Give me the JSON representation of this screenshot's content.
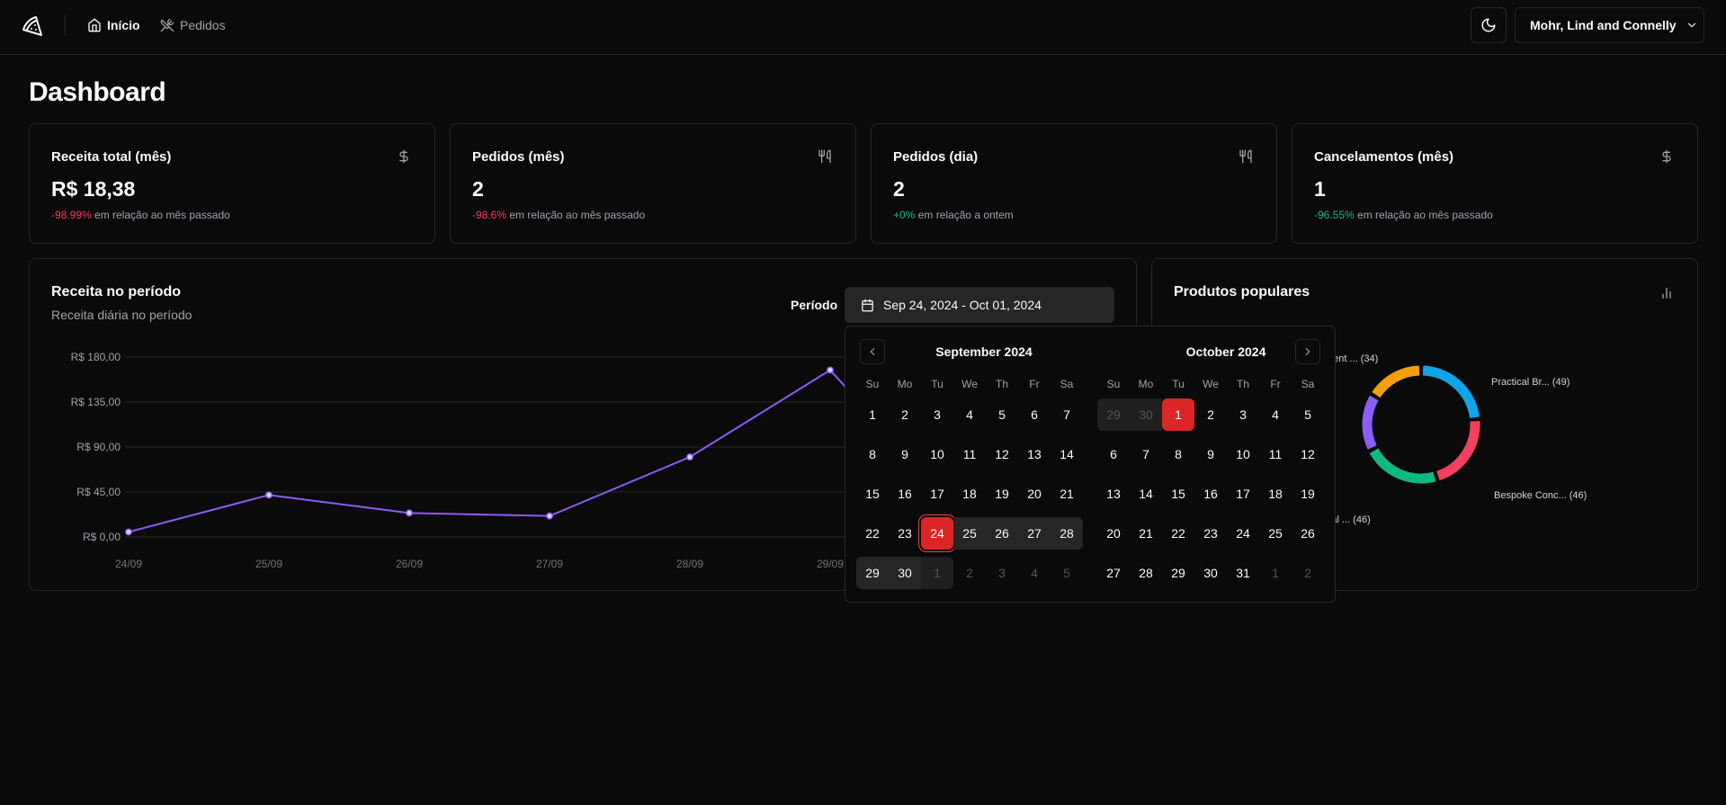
{
  "header": {
    "nav": {
      "home": "Início",
      "orders": "Pedidos"
    },
    "store": "Mohr, Lind and Connelly"
  },
  "page": {
    "title": "Dashboard"
  },
  "cards": [
    {
      "title": "Receita total (mês)",
      "value": "R$ 18,38",
      "delta": "-98.99%",
      "delta_tone": "neg",
      "desc": " em relação ao mês passado",
      "icon": "dollar-icon"
    },
    {
      "title": "Pedidos (mês)",
      "value": "2",
      "delta": "-98.6%",
      "delta_tone": "neg",
      "desc": " em relação ao mês passado",
      "icon": "utensils-icon"
    },
    {
      "title": "Pedidos (dia)",
      "value": "2",
      "delta": "+0%",
      "delta_tone": "pos",
      "desc": " em relação a ontem",
      "icon": "utensils-icon"
    },
    {
      "title": "Cancelamentos (mês)",
      "value": "1",
      "delta": "-96.55%",
      "delta_tone": "pos",
      "desc": " em relação ao mês passado",
      "icon": "dollar-icon"
    }
  ],
  "revenue": {
    "title": "Receita no período",
    "subtitle": "Receita diária no período",
    "period_label": "Período",
    "date_range": "Sep 24, 2024 - Oct 01, 2024"
  },
  "popular": {
    "title": "Produtos populares"
  },
  "calendar": {
    "weekdays": [
      "Su",
      "Mo",
      "Tu",
      "We",
      "Th",
      "Fr",
      "Sa"
    ],
    "months": [
      {
        "title": "September 2024",
        "weeks": [
          [
            "1",
            "2",
            "3",
            "4",
            "5",
            "6",
            "7"
          ],
          [
            "8",
            "9",
            "10",
            "11",
            "12",
            "13",
            "14"
          ],
          [
            "15",
            "16",
            "17",
            "18",
            "19",
            "20",
            "21"
          ],
          [
            "22",
            "23",
            "24",
            "25",
            "26",
            "27",
            "28"
          ],
          [
            "29",
            "30",
            "1",
            "2",
            "3",
            "4",
            "5"
          ]
        ]
      },
      {
        "title": "October 2024",
        "weeks": [
          [
            "29",
            "30",
            "1",
            "2",
            "3",
            "4",
            "5"
          ],
          [
            "6",
            "7",
            "8",
            "9",
            "10",
            "11",
            "12"
          ],
          [
            "13",
            "14",
            "15",
            "16",
            "17",
            "18",
            "19"
          ],
          [
            "20",
            "21",
            "22",
            "23",
            "24",
            "25",
            "26"
          ],
          [
            "27",
            "28",
            "29",
            "30",
            "31",
            "1",
            "2"
          ]
        ]
      }
    ]
  },
  "colors": {
    "line": "#8b5cf6",
    "neg": "#f43f5e",
    "pos": "#10b981",
    "selected": "#dc2626"
  },
  "chart_data": [
    {
      "type": "line",
      "x": [
        "24/09",
        "25/09",
        "26/09",
        "27/09",
        "28/09",
        "29/09"
      ],
      "series": [
        {
          "values": [
            5,
            42,
            24,
            21,
            80,
            167
          ]
        }
      ],
      "yticks": [
        "R$ 0,00",
        "R$ 45,00",
        "R$ 90,00",
        "R$ 135,00",
        "R$ 180,00"
      ],
      "ylim": [
        0,
        180
      ]
    },
    {
      "type": "pie",
      "categories": [
        "Practical Br...",
        "Bespoke Conc...",
        "...etal ...",
        "...",
        "...ligent ..."
      ],
      "labels": [
        "Practical Br... (49)",
        "Bespoke Conc... (46)",
        "...etal ... (46)",
        "...ligent ... (34)"
      ],
      "values": [
        49,
        46,
        46,
        34,
        34
      ],
      "colors": [
        "#0ea5e9",
        "#f43f5e",
        "#10b981",
        "#8b5cf6",
        "#f59e0b"
      ]
    }
  ]
}
